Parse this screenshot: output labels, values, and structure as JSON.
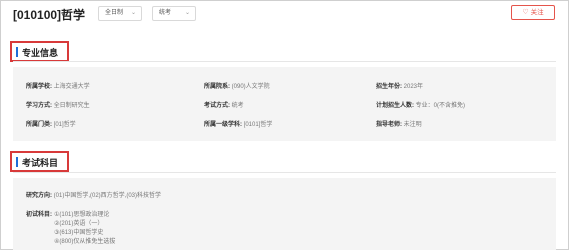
{
  "header": {
    "title": "[010100]哲学",
    "study_mode_select": "全日制",
    "exam_type_select": "统考",
    "follow_label": "关注"
  },
  "sections": {
    "info_title": "专业信息",
    "exam_title": "考试科目"
  },
  "info": {
    "school_label": "所属学校:",
    "school_value": "上海交通大学",
    "dept_label": "所属院系:",
    "dept_value": "(090)人文学院",
    "year_label": "招生年份:",
    "year_value": "2023年",
    "mode_label": "学习方式:",
    "mode_value": "全日制研究生",
    "exam_label": "考试方式:",
    "exam_value": "统考",
    "plan_label": "计划招生人数:",
    "plan_value": "专业：0(不含推免)",
    "category_label": "所属门类:",
    "category_value": "[01]哲学",
    "discipline_label": "所属一级学科:",
    "discipline_value": "[0101]哲学",
    "advisor_label": "指导老师:",
    "advisor_value": "未注明"
  },
  "exam": {
    "direction_label": "研究方向:",
    "direction_value": "(01)中国哲学,(02)西方哲学,(03)科技哲学",
    "subjects_label": "初试科目:",
    "subjects": [
      "①(101)思想政治理论",
      "②(201)英语（一）",
      "③(613)中国哲学史",
      "④(800)仅从推免生选拔"
    ]
  }
}
